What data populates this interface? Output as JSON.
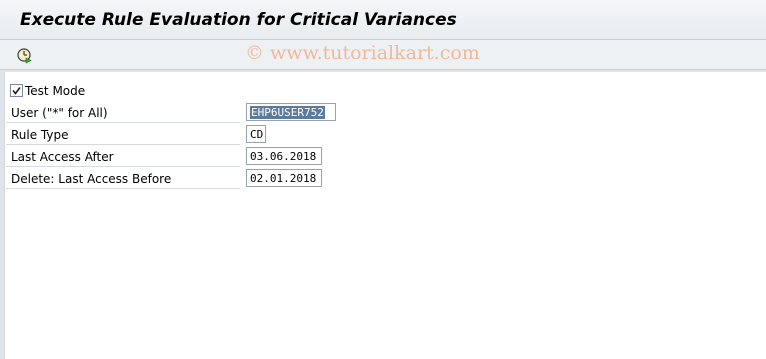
{
  "window": {
    "title": "Execute Rule Evaluation for Critical Variances"
  },
  "toolbar": {
    "execute_icon": "execute-clock-icon"
  },
  "watermark": {
    "text": "© www.tutorialkart.com"
  },
  "form": {
    "test_mode_label": "Test Mode",
    "test_mode_checked": true,
    "user_label": "User (\"*\" for All)",
    "user_value": "EHP6USER752",
    "rule_type_label": "Rule Type",
    "rule_type_value": "CD",
    "last_access_after_label": "Last Access After",
    "last_access_after_value": "03.06.2018",
    "delete_last_access_before_label": "Delete: Last Access Before",
    "delete_last_access_before_value": "02.01.2018"
  }
}
